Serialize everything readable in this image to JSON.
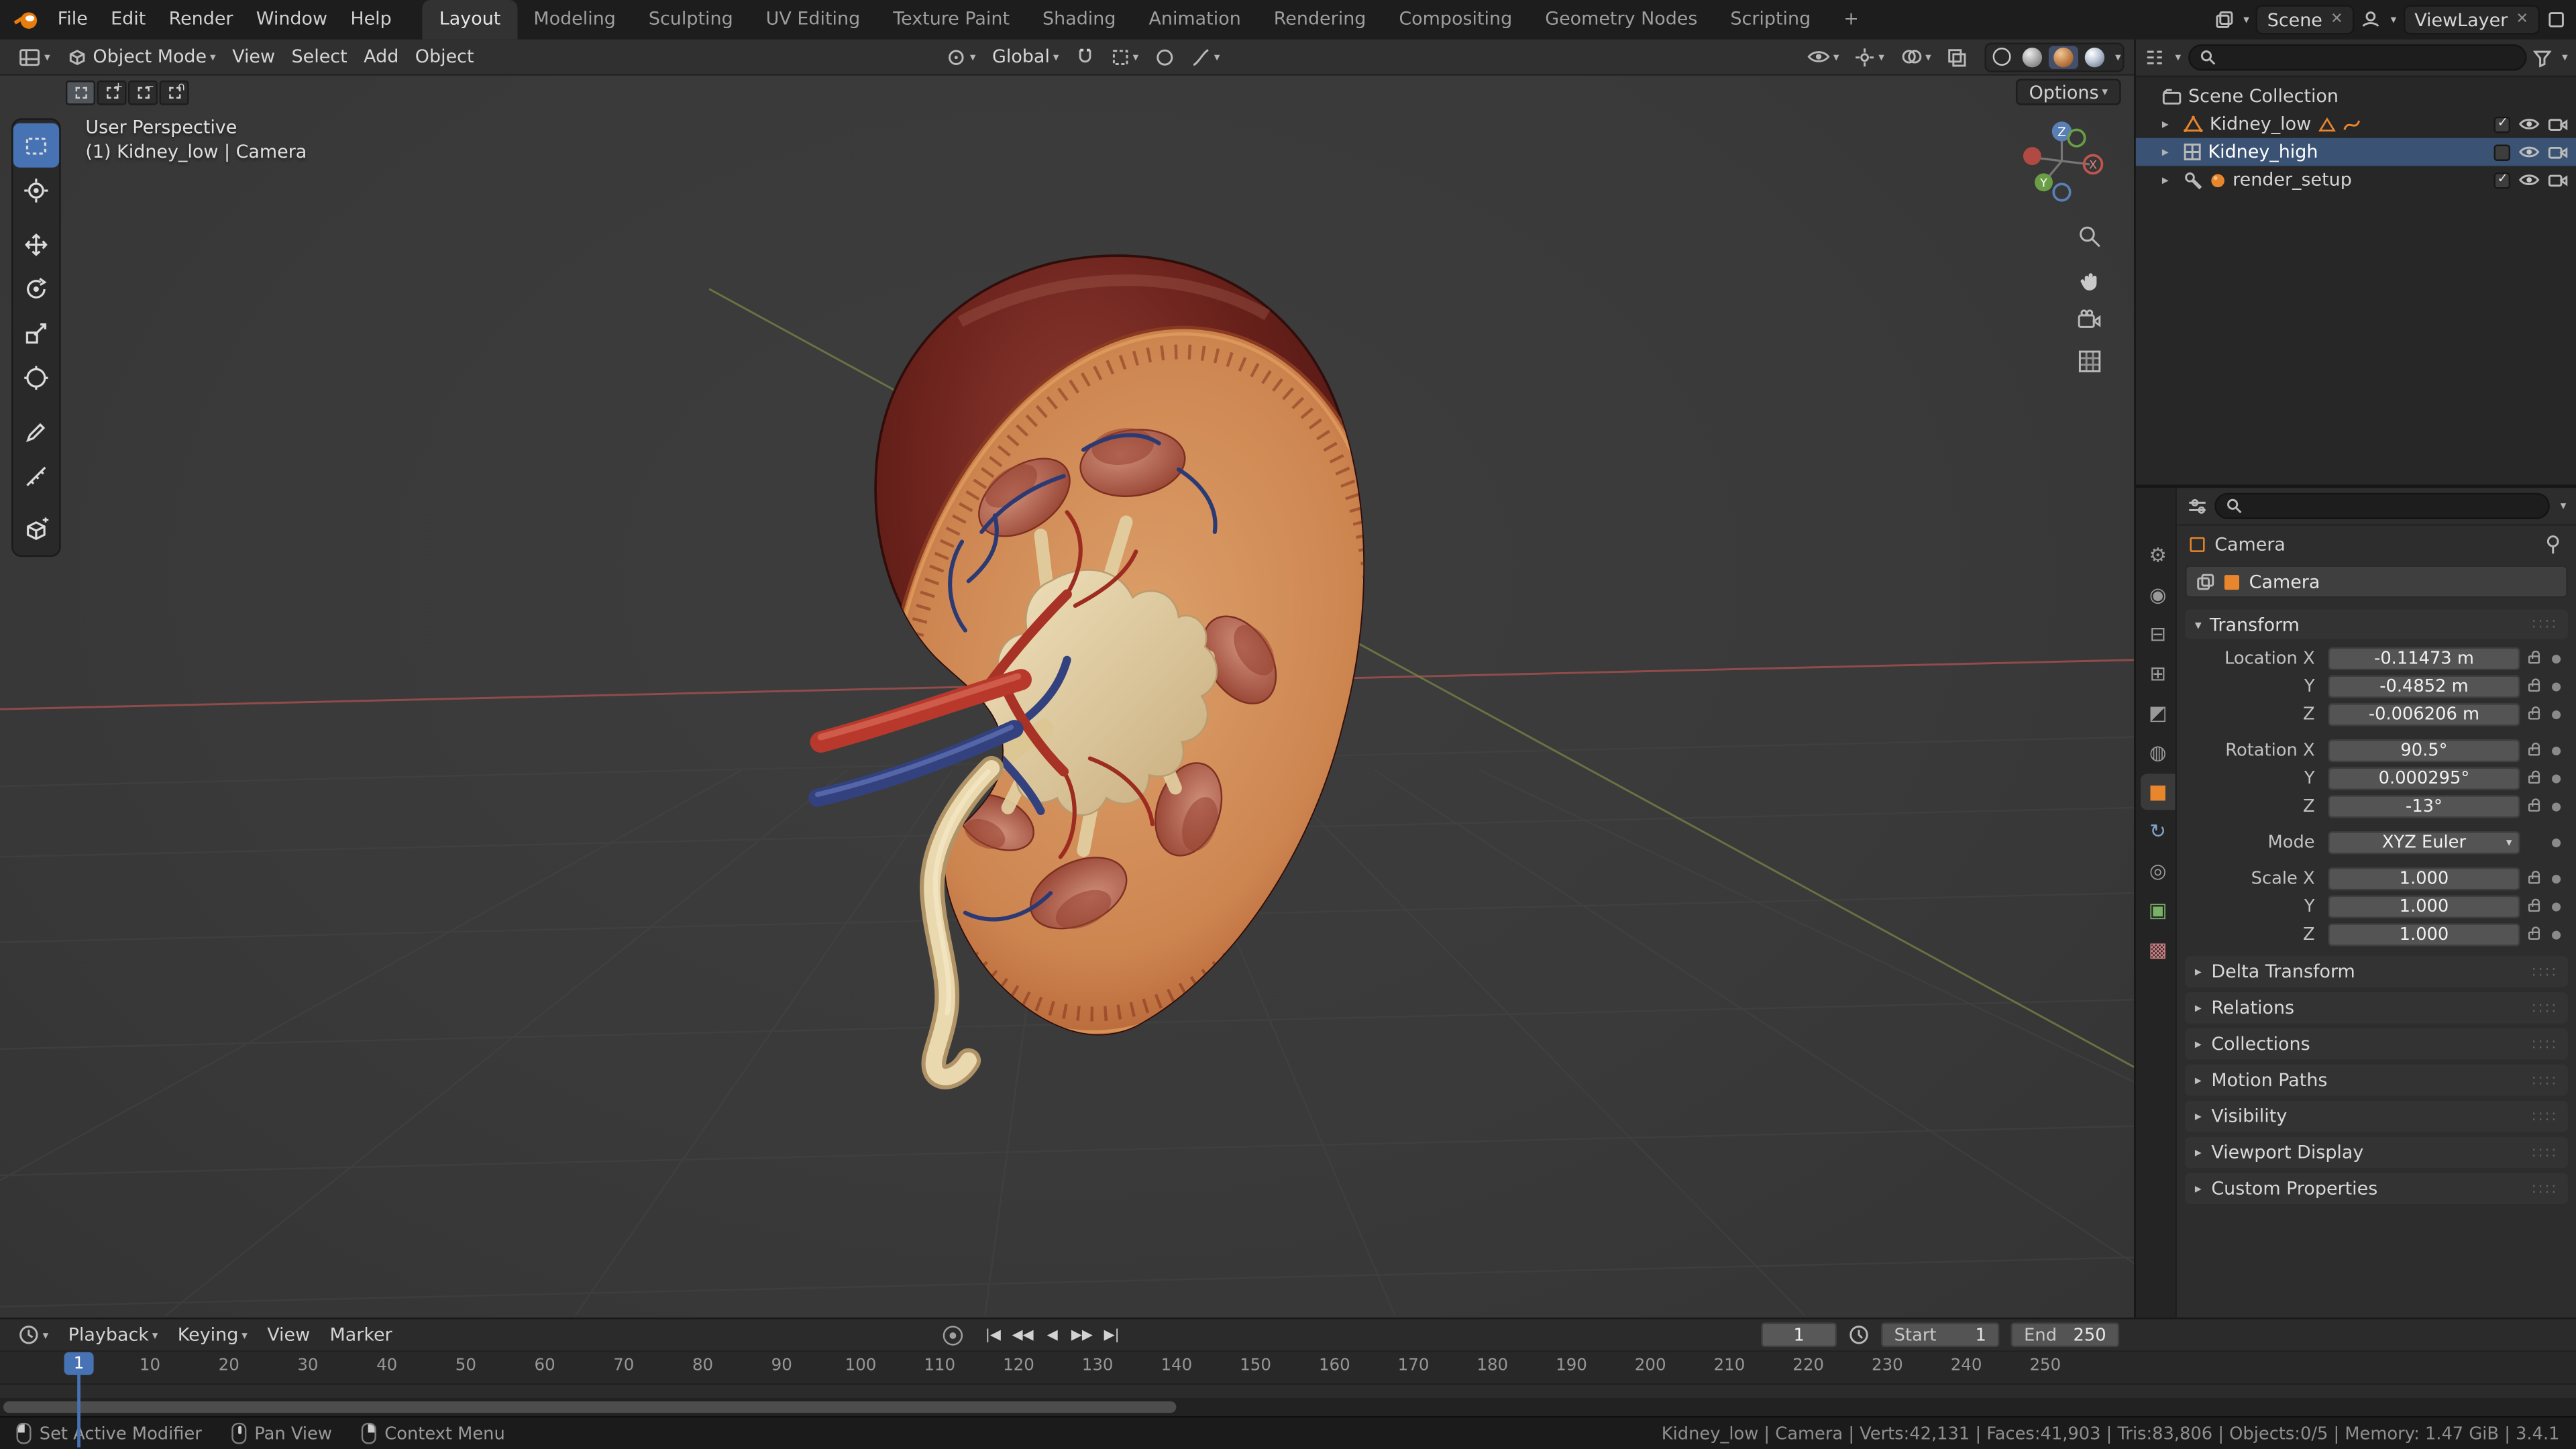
{
  "topbar": {
    "menus": [
      "File",
      "Edit",
      "Render",
      "Window",
      "Help"
    ],
    "tabs": [
      "Layout",
      "Modeling",
      "Sculpting",
      "UV Editing",
      "Texture Paint",
      "Shading",
      "Animation",
      "Rendering",
      "Compositing",
      "Geometry Nodes",
      "Scripting"
    ],
    "active_tab": "Layout",
    "add_tab_label": "+",
    "scene_name": "Scene",
    "viewlayer_name": "ViewLayer",
    "icons": [
      "blender-logo-icon",
      "browse-scene-icon",
      "close-icon",
      "browse-viewlayer-icon",
      "copy-icon"
    ]
  },
  "viewport": {
    "header": {
      "mode": "Object Mode",
      "menus": [
        "View",
        "Select",
        "Add",
        "Object"
      ],
      "orientation": "Global",
      "icons": [
        "editor-type-icon",
        "pivot-icon",
        "magnet-icon",
        "snap-target-icon",
        "proportional-icon",
        "falloff-icon",
        "visibility-icon",
        "gizmo-icon",
        "overlays-icon",
        "xray-icon",
        "wireframe-icon",
        "solid-icon",
        "material-preview-icon",
        "rendered-icon"
      ]
    },
    "tool_options_label": "Options",
    "overlay": {
      "line1": "User Perspective",
      "line2": "(1) Kidney_low | Camera"
    },
    "gizmo_axes": [
      "Z",
      "X",
      "Y"
    ],
    "toolbar_tools": [
      "select-box",
      "cursor",
      "move",
      "rotate",
      "scale",
      "transform",
      "annotate",
      "measure",
      "add-cube"
    ],
    "side_buttons": [
      "zoom-icon",
      "pan-hand-icon",
      "camera-view-icon",
      "toggle-ortho-icon"
    ]
  },
  "outliner": {
    "rows": [
      {
        "label": "Scene Collection"
      },
      {
        "label": "Kidney_low"
      },
      {
        "label": "Kidney_high"
      },
      {
        "label": "render_setup"
      }
    ],
    "icons": [
      "collection-icon",
      "mesh-triangle-icon",
      "mesh-data-icon",
      "action-icon",
      "mesh-grid-icon",
      "wrench-icon",
      "material-sphere-icon",
      "checkbox",
      "eye-icon",
      "camera-icon",
      "filter-funnel-icon",
      "search-icon"
    ]
  },
  "properties": {
    "tabs": [
      {
        "name": "tool",
        "glyph": "⚙",
        "color": "#9a9a9a",
        "active": false
      },
      {
        "name": "render",
        "glyph": "◉",
        "color": "#9a9a9a",
        "active": false
      },
      {
        "name": "output",
        "glyph": "⊟",
        "color": "#9a9a9a",
        "active": false
      },
      {
        "name": "view-layer",
        "glyph": "⊞",
        "color": "#9a9a9a",
        "active": false
      },
      {
        "name": "scene",
        "glyph": "◩",
        "color": "#9a9a9a",
        "active": false
      },
      {
        "name": "world",
        "glyph": "◍",
        "color": "#9a9a9a",
        "active": false
      },
      {
        "name": "object",
        "glyph": "■",
        "color": "#e8862d",
        "active": true
      },
      {
        "name": "physics",
        "glyph": "↻",
        "color": "#7fa3c9",
        "active": false
      },
      {
        "name": "constraints",
        "glyph": "◎",
        "color": "#9a9a9a",
        "active": false
      },
      {
        "name": "object-data",
        "glyph": "▣",
        "color": "#77b267",
        "active": false
      },
      {
        "name": "texture",
        "glyph": "▩",
        "color": "#c97f7f",
        "active": false
      }
    ],
    "breadcrumb": "Camera",
    "object_name": "Camera",
    "transform_title": "Transform",
    "rows": [
      {
        "label": "Location X",
        "value": "-0.11473 m"
      },
      {
        "label": "Y",
        "value": "-0.4852 m"
      },
      {
        "label": "Z",
        "value": "-0.006206 m"
      },
      {
        "label": "Rotation X",
        "value": "90.5°"
      },
      {
        "label": "Y",
        "value": "0.000295°"
      },
      {
        "label": "Z",
        "value": "-13°"
      },
      {
        "label": "Mode",
        "value": "XYZ Euler"
      },
      {
        "label": "Scale X",
        "value": "1.000"
      },
      {
        "label": "Y",
        "value": "1.000"
      },
      {
        "label": "Z",
        "value": "1.000"
      }
    ],
    "sections": [
      "Delta Transform",
      "Relations",
      "Collections",
      "Motion Paths",
      "Visibility",
      "Viewport Display",
      "Custom Properties"
    ]
  },
  "timeline": {
    "menus": [
      "Playback",
      "Keying",
      "View",
      "Marker"
    ],
    "current_frame": "1",
    "playhead_frame": "1",
    "start_label": "Start",
    "start_value": "1",
    "end_label": "End",
    "end_value": "250",
    "ruler": [
      10,
      20,
      30,
      40,
      50,
      60,
      70,
      80,
      90,
      100,
      110,
      120,
      130,
      140,
      150,
      160,
      170,
      180,
      190,
      200,
      210,
      220,
      230,
      240,
      250
    ],
    "icons": [
      "clock-icon",
      "record-icon",
      "jump-to-start-icon",
      "prev-keyframe-icon",
      "play-reverse-icon",
      "play-icon",
      "next-keyframe-icon",
      "jump-to-end-icon"
    ]
  },
  "statusbar": {
    "hints": [
      "Set Active Modifier",
      "Pan View",
      "Context Menu"
    ],
    "stats": "Kidney_low | Camera | Verts:42,131 | Faces:41,903 | Tris:83,806 | Objects:0/5 | Memory: 1.47 GiB | 3.4.1"
  },
  "colors": {
    "accent": "#4772b3",
    "object_orange": "#e8862d",
    "selection": "#3a5273",
    "artery_red": "#b8392c",
    "vein_blue": "#33427e",
    "capsule_maroon": "#5c1b16",
    "cortex_orange": "#c0703c"
  }
}
